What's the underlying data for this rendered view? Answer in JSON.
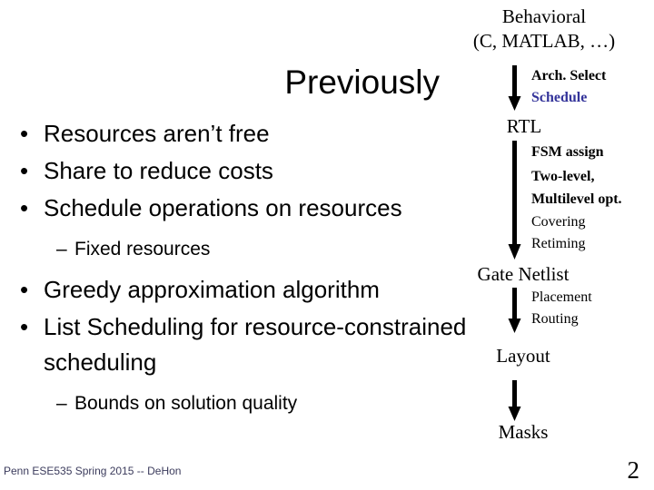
{
  "slide": {
    "title": "Previously",
    "footer": "Penn ESE535 Spring 2015 -- DeHon",
    "page_number": "2",
    "accent_color": "#33339a",
    "footer_color": "#3b3b5c"
  },
  "bullets": [
    {
      "level": 1,
      "marker": "•",
      "text": "Resources aren’t free"
    },
    {
      "level": 1,
      "marker": "•",
      "text": "Share to reduce costs"
    },
    {
      "level": 1,
      "marker": "•",
      "text": "Schedule operations on resources"
    },
    {
      "level": 2,
      "marker": "–",
      "text": "Fixed resources"
    },
    {
      "level": 1,
      "marker": "•",
      "text": "Greedy approximation algorithm"
    },
    {
      "level": 1,
      "marker": "•",
      "text": "List Scheduling for resource-constrained scheduling"
    },
    {
      "level": 2,
      "marker": "–",
      "text": "Bounds on solution quality"
    }
  ],
  "flow": {
    "nodes": [
      {
        "id": "behavioral-line1",
        "label": "Behavioral"
      },
      {
        "id": "behavioral-line2",
        "label": "(C, MATLAB, …)"
      },
      {
        "id": "rtl",
        "label": "RTL"
      },
      {
        "id": "gate-netlist",
        "label": "Gate Netlist"
      },
      {
        "id": "layout",
        "label": "Layout"
      },
      {
        "id": "masks",
        "label": "Masks"
      }
    ],
    "edge_labels": [
      {
        "id": "arch-select",
        "label": "Arch. Select",
        "accent": false
      },
      {
        "id": "schedule",
        "label": "Schedule",
        "accent": true
      },
      {
        "id": "fsm-assign",
        "label": "FSM assign",
        "accent": false
      },
      {
        "id": "two-level",
        "label": "Two-level,",
        "accent": false
      },
      {
        "id": "multilevel-opt",
        "label": "Multilevel opt.",
        "accent": false
      },
      {
        "id": "covering",
        "label": "Covering",
        "accent": false
      },
      {
        "id": "retiming",
        "label": "Retiming",
        "accent": false
      },
      {
        "id": "placement",
        "label": "Placement",
        "accent": false
      },
      {
        "id": "routing",
        "label": "Routing",
        "accent": false
      }
    ],
    "arrows": [
      {
        "id": "arrow-behavioral-to-rtl"
      },
      {
        "id": "arrow-rtl-to-gate-netlist"
      },
      {
        "id": "arrow-gate-netlist-to-layout"
      },
      {
        "id": "arrow-layout-to-masks"
      }
    ]
  }
}
